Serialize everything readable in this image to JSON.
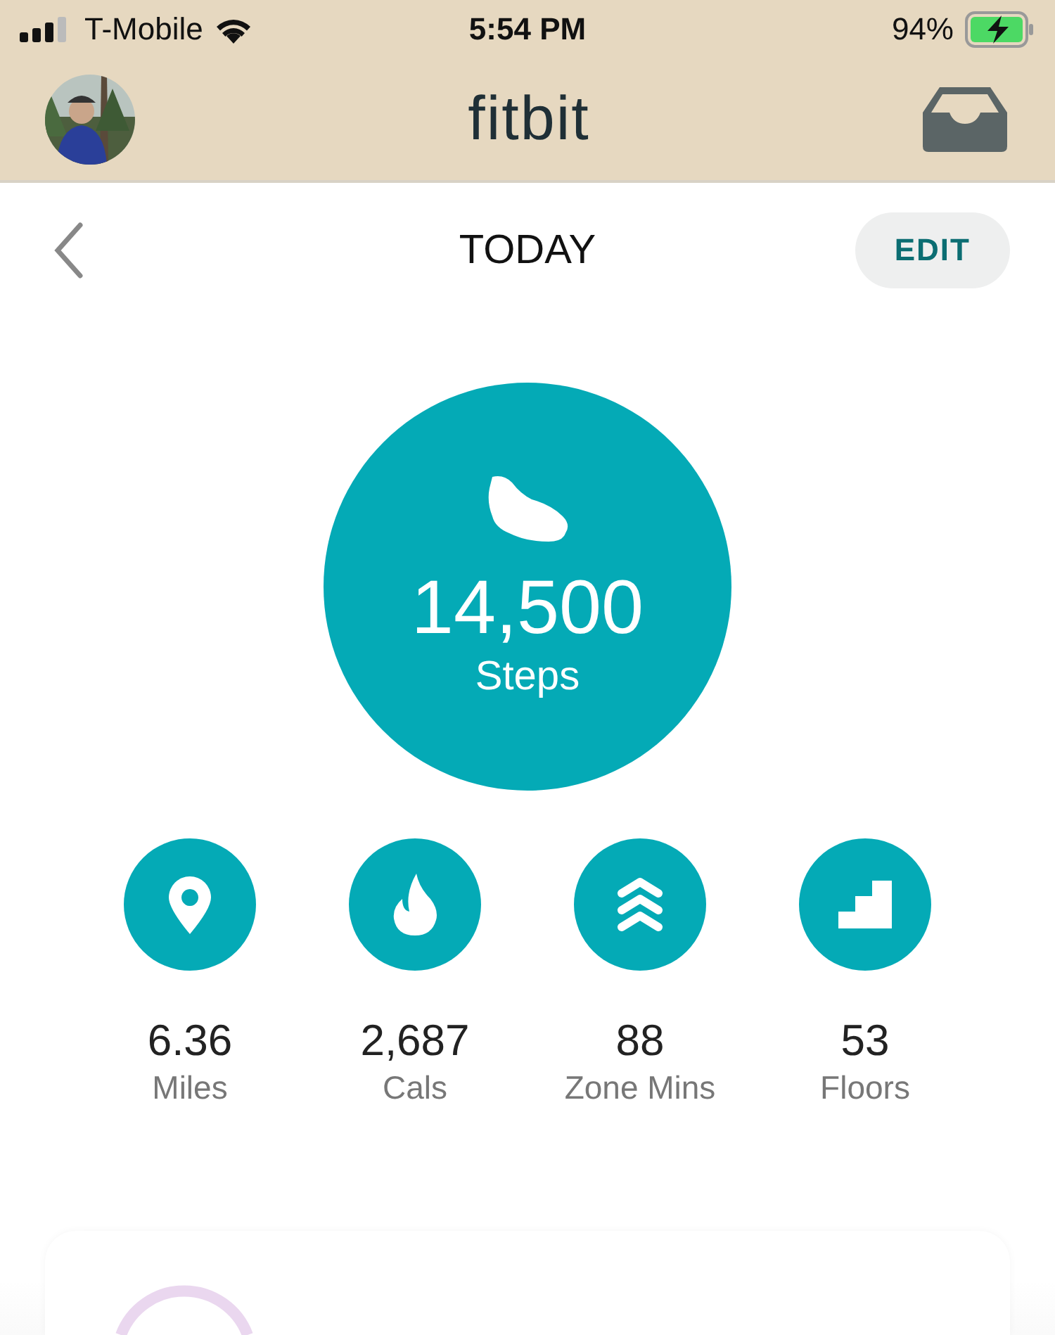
{
  "status_bar": {
    "carrier": "T-Mobile",
    "time": "5:54 PM",
    "battery": "94%"
  },
  "header": {
    "logo": "fitbit"
  },
  "nav": {
    "title": "TODAY",
    "edit_button": "EDIT"
  },
  "steps": {
    "value": "14,500",
    "label": "Steps"
  },
  "stats": [
    {
      "kind": "distance",
      "value": "6.36",
      "label": "Miles"
    },
    {
      "kind": "calories",
      "value": "2,687",
      "label": "Cals"
    },
    {
      "kind": "zone",
      "value": "88",
      "label": "Zone Mins"
    },
    {
      "kind": "floors",
      "value": "53",
      "label": "Floors"
    }
  ]
}
